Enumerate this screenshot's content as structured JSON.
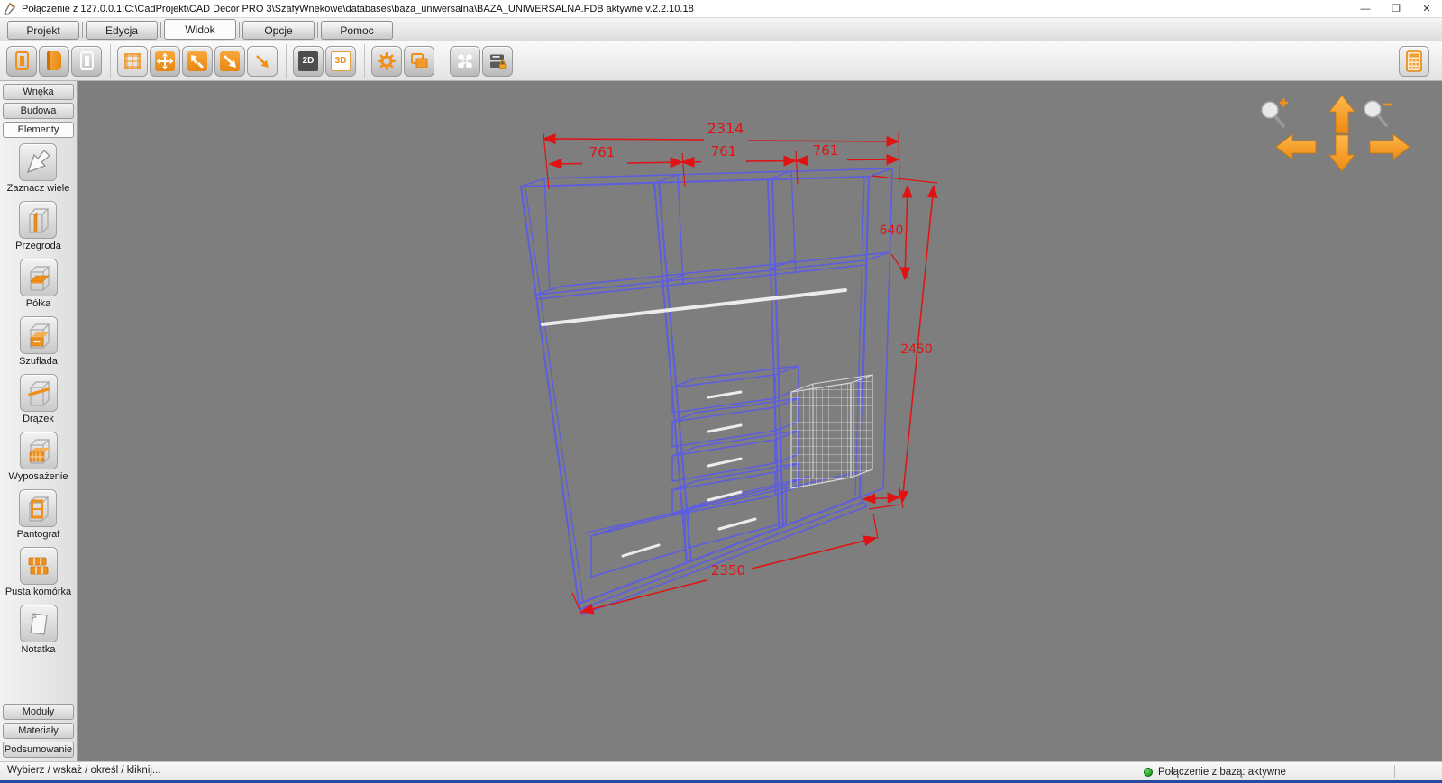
{
  "window": {
    "title": "Połączenie z 127.0.0.1:C:\\CadProjekt\\CAD Decor PRO 3\\SzafyWnekowe\\databases\\baza_uniwersalna\\BAZA_UNIWERSALNA.FDB aktywne  v.2.2.10.18",
    "controls": {
      "minimize": "—",
      "restore": "❐",
      "close": "✕"
    }
  },
  "tabs": [
    {
      "label": "Projekt"
    },
    {
      "label": "Edycja"
    },
    {
      "label": "Widok"
    },
    {
      "label": "Opcje"
    },
    {
      "label": "Pomoc"
    }
  ],
  "toolbar": {
    "view2d": "2D",
    "view3d": "3D",
    "icons": [
      "wardrobe-panel-icon",
      "wardrobe-solid-icon",
      "wardrobe-outline-icon",
      "grid-view-icon",
      "fit-view-icon",
      "edit-selection-icon",
      "zoom-window-icon",
      "zoom-extents-icon",
      "view-2d-icon",
      "view-3d-icon",
      "settings-gear-icon",
      "layers-icon",
      "center-view-icon",
      "save-database-lock-icon",
      "calculator-icon"
    ]
  },
  "sidebar": {
    "top_tabs": [
      {
        "label": "Wnęka"
      },
      {
        "label": "Budowa"
      },
      {
        "label": "Elementy"
      }
    ],
    "tools": [
      {
        "label": "Zaznacz wiele"
      },
      {
        "label": "Przegroda"
      },
      {
        "label": "Półka"
      },
      {
        "label": "Szuflada"
      },
      {
        "label": "Drążek"
      },
      {
        "label": "Wyposażenie"
      },
      {
        "label": "Pantograf"
      },
      {
        "label": "Pusta komórka"
      },
      {
        "label": "Notatka"
      }
    ],
    "bottom_tabs": [
      {
        "label": "Moduły"
      },
      {
        "label": "Materiały"
      },
      {
        "label": "Podsumowanie"
      }
    ]
  },
  "canvas": {
    "dimensions": {
      "total_width": "2314",
      "sections": [
        "761",
        "761",
        "761"
      ],
      "top_height": "640",
      "total_height": "2450",
      "bottom_width": "2350"
    },
    "nav_icons": [
      "zoom-in-icon",
      "zoom-out-icon",
      "pan-up-icon",
      "pan-down-icon",
      "pan-left-icon",
      "pan-right-icon"
    ]
  },
  "statusbar": {
    "hint": "Wybierz / wskaż / określ / kliknij...",
    "connection": "Połączenie z bazą: aktywne"
  },
  "colors": {
    "accent": "#ef8f1c",
    "wireframe": "#5d5de0",
    "dimension": "#e01212",
    "canvas_bg": "#7e7e7e",
    "connection_ok": "#118611"
  }
}
